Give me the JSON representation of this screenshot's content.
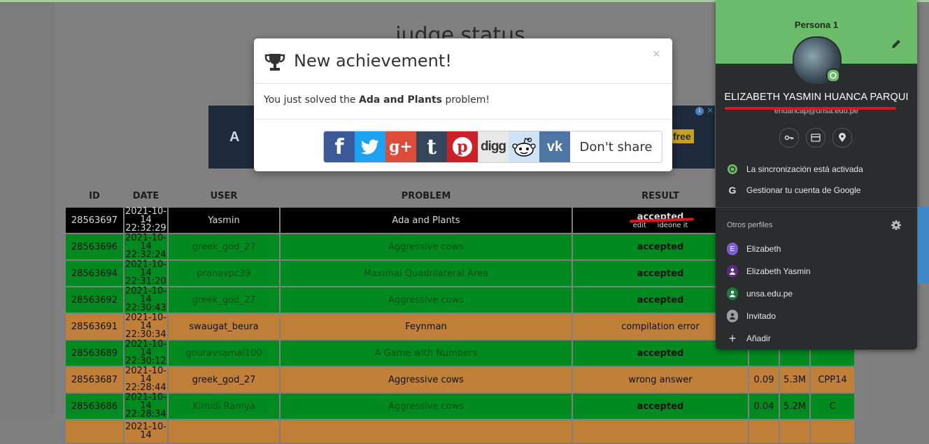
{
  "page": {
    "title": "judge status"
  },
  "ad": {
    "free_label": "free",
    "letter": "A"
  },
  "table": {
    "headers": [
      "ID",
      "DATE",
      "USER",
      "PROBLEM",
      "RESULT"
    ],
    "rows": [
      {
        "id": "28563697",
        "date": "2021-10-14",
        "time": "22:32:29",
        "user": "Yasmin",
        "problem": "Ada and Plants",
        "result": "accepted",
        "link1": "edit",
        "link2": "ideone it",
        "status": "black"
      },
      {
        "id": "28563696",
        "date": "2021-10-14",
        "time": "22:32:24",
        "user": "greek_god_27",
        "problem": "Aggressive cows",
        "result": "accepted",
        "status": "green"
      },
      {
        "id": "28563694",
        "date": "2021-10-14",
        "time": "22:31:20",
        "user": "pranavpc39",
        "problem": "Maximal Quadrilateral Area",
        "result": "accepted",
        "status": "green"
      },
      {
        "id": "28563692",
        "date": "2021-10-14",
        "time": "22:30:43",
        "user": "greek_god_27",
        "problem": "Aggressive cows",
        "result": "accepted",
        "status": "green"
      },
      {
        "id": "28563691",
        "date": "2021-10-14",
        "time": "22:30:34",
        "user": "swaugat_beura",
        "problem": "Feynman",
        "result": "compilation error",
        "status": "orange"
      },
      {
        "id": "28563689",
        "date": "2021-10-14",
        "time": "22:30:12",
        "user": "gouravsamal100",
        "problem": "A Game with Numbers",
        "result": "accepted",
        "status": "green"
      },
      {
        "id": "28563687",
        "date": "2021-10-14",
        "time": "22:28:44",
        "user": "greek_god_27",
        "problem": "Aggressive cows",
        "result": "wrong answer",
        "time_s": "0.09",
        "mem": "5.3M",
        "lang": "CPP14",
        "status": "orange"
      },
      {
        "id": "28563686",
        "date": "2021-10-14",
        "time": "22:28:34",
        "user": "Kimidi Ramya",
        "problem": "Aggressive cows",
        "result": "accepted",
        "time_s": "0.04",
        "mem": "5.2M",
        "lang": "C",
        "status": "green"
      },
      {
        "id": "",
        "date": "2021-10-14",
        "time": "",
        "user": "",
        "problem": "",
        "result": "",
        "status": "orange"
      }
    ]
  },
  "modal": {
    "title": "New achievement!",
    "close": "×",
    "body_prefix": "You just solved the ",
    "body_problem": "Ada and Plants",
    "body_suffix": " problem!",
    "share_buttons": [
      {
        "name": "facebook",
        "glyph": "f",
        "color": "#3b5998"
      },
      {
        "name": "twitter",
        "glyph": "t",
        "color": "#1da1f2"
      },
      {
        "name": "google-plus",
        "glyph": "g+",
        "color": "#dd4b39"
      },
      {
        "name": "tumblr",
        "glyph": "t",
        "color": "#35465c"
      },
      {
        "name": "pinterest",
        "glyph": "P",
        "color": "#cb2027"
      },
      {
        "name": "digg",
        "glyph": "digg",
        "color": "#e8e8e8"
      },
      {
        "name": "reddit",
        "glyph": "reddit",
        "color": "#cee3f8"
      },
      {
        "name": "vk",
        "glyph": "vk",
        "color": "#4c75a3"
      }
    ],
    "dont_share": "Don't share"
  },
  "profile": {
    "header": "Persona 1",
    "full_name": "ELIZABETH YASMIN HUANCA PARQUI",
    "email": "ehuancap@unsa.edu.pe",
    "icons": [
      "key-icon",
      "card-icon",
      "location-icon"
    ],
    "sync": "La sincronización está activada",
    "manage": "Gestionar tu cuenta de Google",
    "other_title": "Otros perfiles",
    "others": [
      {
        "label": "Elizabeth",
        "initial": "E",
        "color": "#7b5cd6"
      },
      {
        "label": "Elizabeth Yasmin",
        "initial": "",
        "color": "#5b2a86"
      },
      {
        "label": "unsa.edu.pe",
        "initial": "",
        "color": "#1a7a3a"
      },
      {
        "label": "Invitado",
        "initial": "",
        "color": "#9aa0a6"
      }
    ],
    "add": "Añadir"
  },
  "colors": {
    "accepted_row": "#008a1f",
    "error_row": "#c0803a",
    "profile_green": "#6bbc6b"
  }
}
